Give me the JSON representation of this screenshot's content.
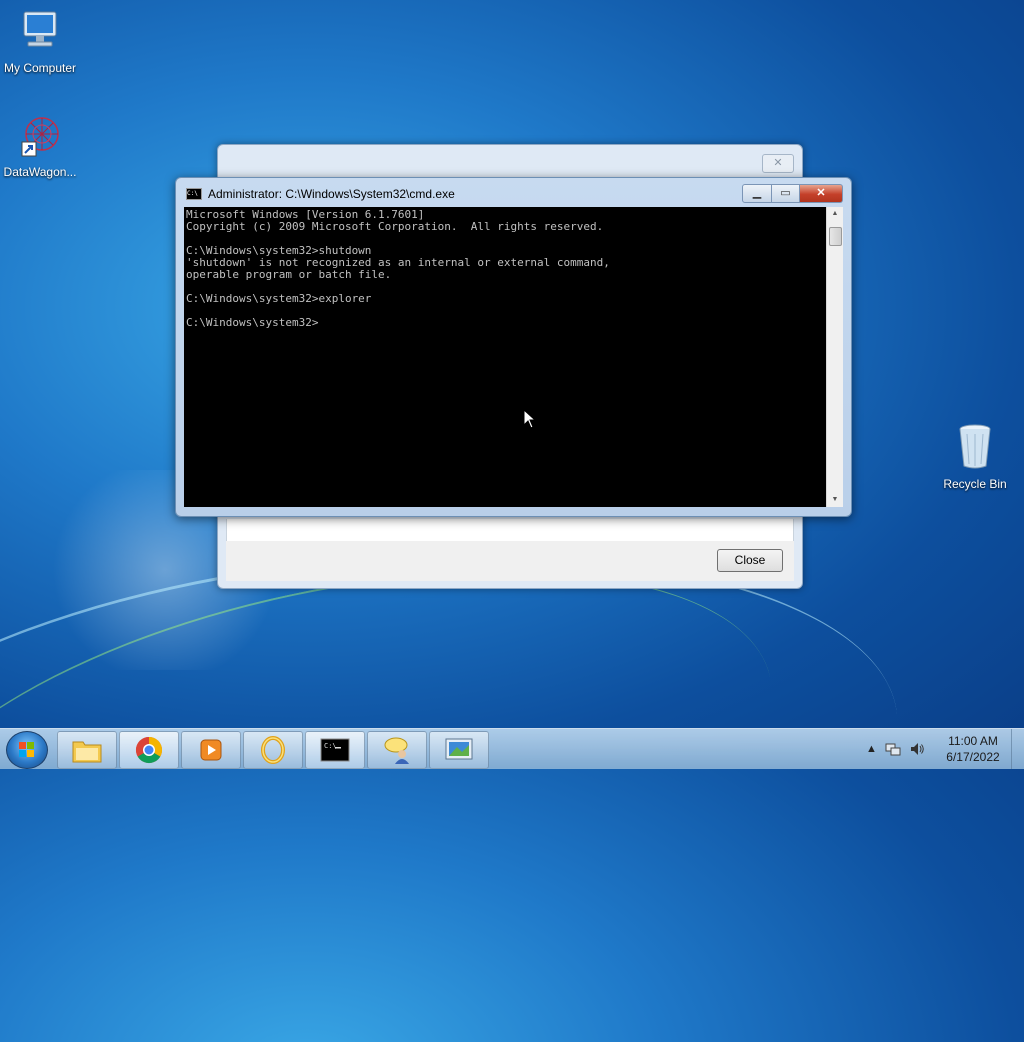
{
  "desktop": {
    "icons": [
      {
        "label": "My Computer"
      },
      {
        "label": "DataWagon..."
      },
      {
        "label": "Recycle Bin"
      }
    ]
  },
  "dialog": {
    "close_button": "Close"
  },
  "cmd": {
    "title": "Administrator: C:\\Windows\\System32\\cmd.exe",
    "lines": [
      "Microsoft Windows [Version 6.1.7601]",
      "Copyright (c) 2009 Microsoft Corporation.  All rights reserved.",
      "",
      "C:\\Windows\\system32>shutdown",
      "'shutdown' is not recognized as an internal or external command,",
      "operable program or batch file.",
      "",
      "C:\\Windows\\system32>explorer",
      "",
      "C:\\Windows\\system32>"
    ]
  },
  "taskbar": {
    "buttons": [
      {
        "name": "file-explorer"
      },
      {
        "name": "chrome"
      },
      {
        "name": "media-player"
      },
      {
        "name": "ring-app"
      },
      {
        "name": "command-prompt"
      },
      {
        "name": "network-user"
      },
      {
        "name": "display-app"
      }
    ],
    "time": "11:00 AM",
    "date": "6/17/2022"
  }
}
